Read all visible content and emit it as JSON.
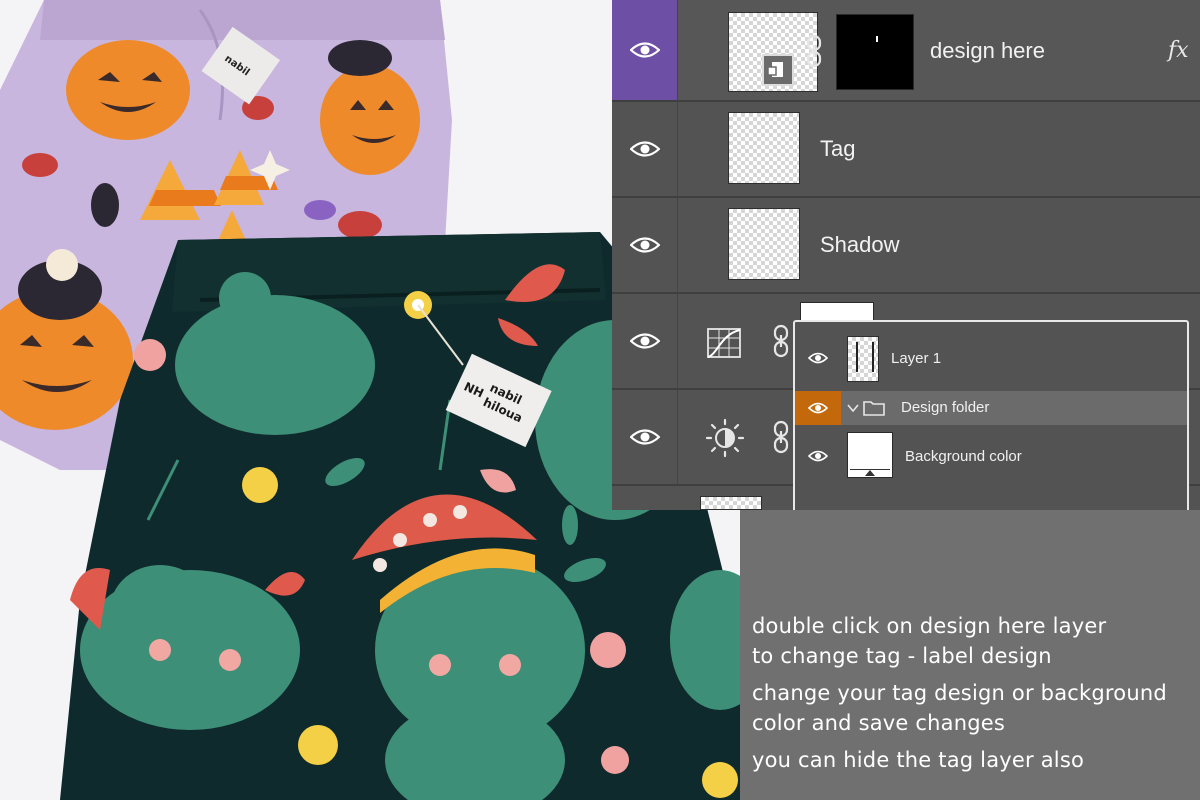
{
  "layers_panel": {
    "layers": [
      {
        "name": "design here",
        "fx": "fx",
        "active": true
      },
      {
        "name": "Tag"
      },
      {
        "name": "Shadow"
      }
    ]
  },
  "popup_panel": {
    "layers": [
      {
        "name": "Layer 1"
      },
      {
        "name": "Design folder",
        "expanded": true,
        "highlight": "#c4690b"
      },
      {
        "name": "Background color"
      }
    ]
  },
  "tag": {
    "brand_line1": "nabil",
    "brand_line2": "hiloua",
    "logo": "NH"
  },
  "instructions": {
    "line1": "double click on design here layer",
    "line2": "to change tag - label design",
    "line3": "change your tag design or background",
    "line4": "color and save changes",
    "line5": "you can hide the tag layer also"
  },
  "colors": {
    "accent_purple": "#6d4fa6",
    "accent_orange": "#c4690b",
    "panel_gray": "#535353",
    "lavender_fabric": "#c9b6de",
    "dark_fabric": "#0f2a2c"
  }
}
